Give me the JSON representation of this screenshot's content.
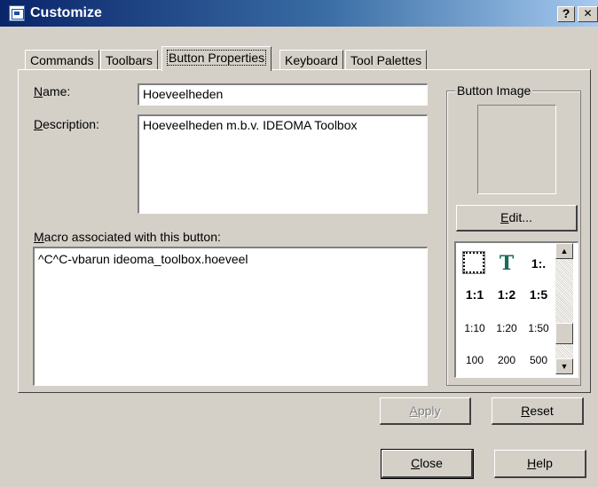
{
  "window": {
    "title": "Customize",
    "help_glyph": "?",
    "close_glyph": "✕"
  },
  "tabs": [
    {
      "label": "Commands"
    },
    {
      "label": "Toolbars"
    },
    {
      "label": "Button Properties",
      "active": true
    },
    {
      "label": "Keyboard"
    },
    {
      "label": "Tool Palettes"
    }
  ],
  "form": {
    "name_label_key": "N",
    "name_label_rest": "ame:",
    "name_value": "Hoeveelheden",
    "description_label_key": "D",
    "description_label_rest": "escription:",
    "description_value": "Hoeveelheden m.b.v. IDEOMA Toolbox",
    "macro_label_key": "M",
    "macro_label_rest": "acro associated with this button:",
    "macro_value": "^C^C-vbarun ideoma_toolbox.hoeveel"
  },
  "button_image": {
    "group_title": "Button Image",
    "edit_key": "E",
    "edit_rest": "dit...",
    "palette": [
      [
        "",
        "T",
        "1:."
      ],
      [
        "1:1",
        "1:2",
        "1:5"
      ],
      [
        "1:10",
        "1:20",
        "1:50"
      ],
      [
        "100",
        "200",
        "500"
      ]
    ],
    "scroll_up": "▲",
    "scroll_down": "▼"
  },
  "actions": {
    "apply_key": "A",
    "apply_rest": "pply",
    "reset_key": "R",
    "reset_rest": "eset",
    "close_key": "C",
    "close_rest": "lose",
    "help_key": "H",
    "help_rest": "elp"
  },
  "colors": {
    "title_gradient_start": "#0a246a",
    "title_gradient_end": "#a6caf0",
    "face": "#d4d0c8",
    "icon_t": "#1a6b5a"
  }
}
